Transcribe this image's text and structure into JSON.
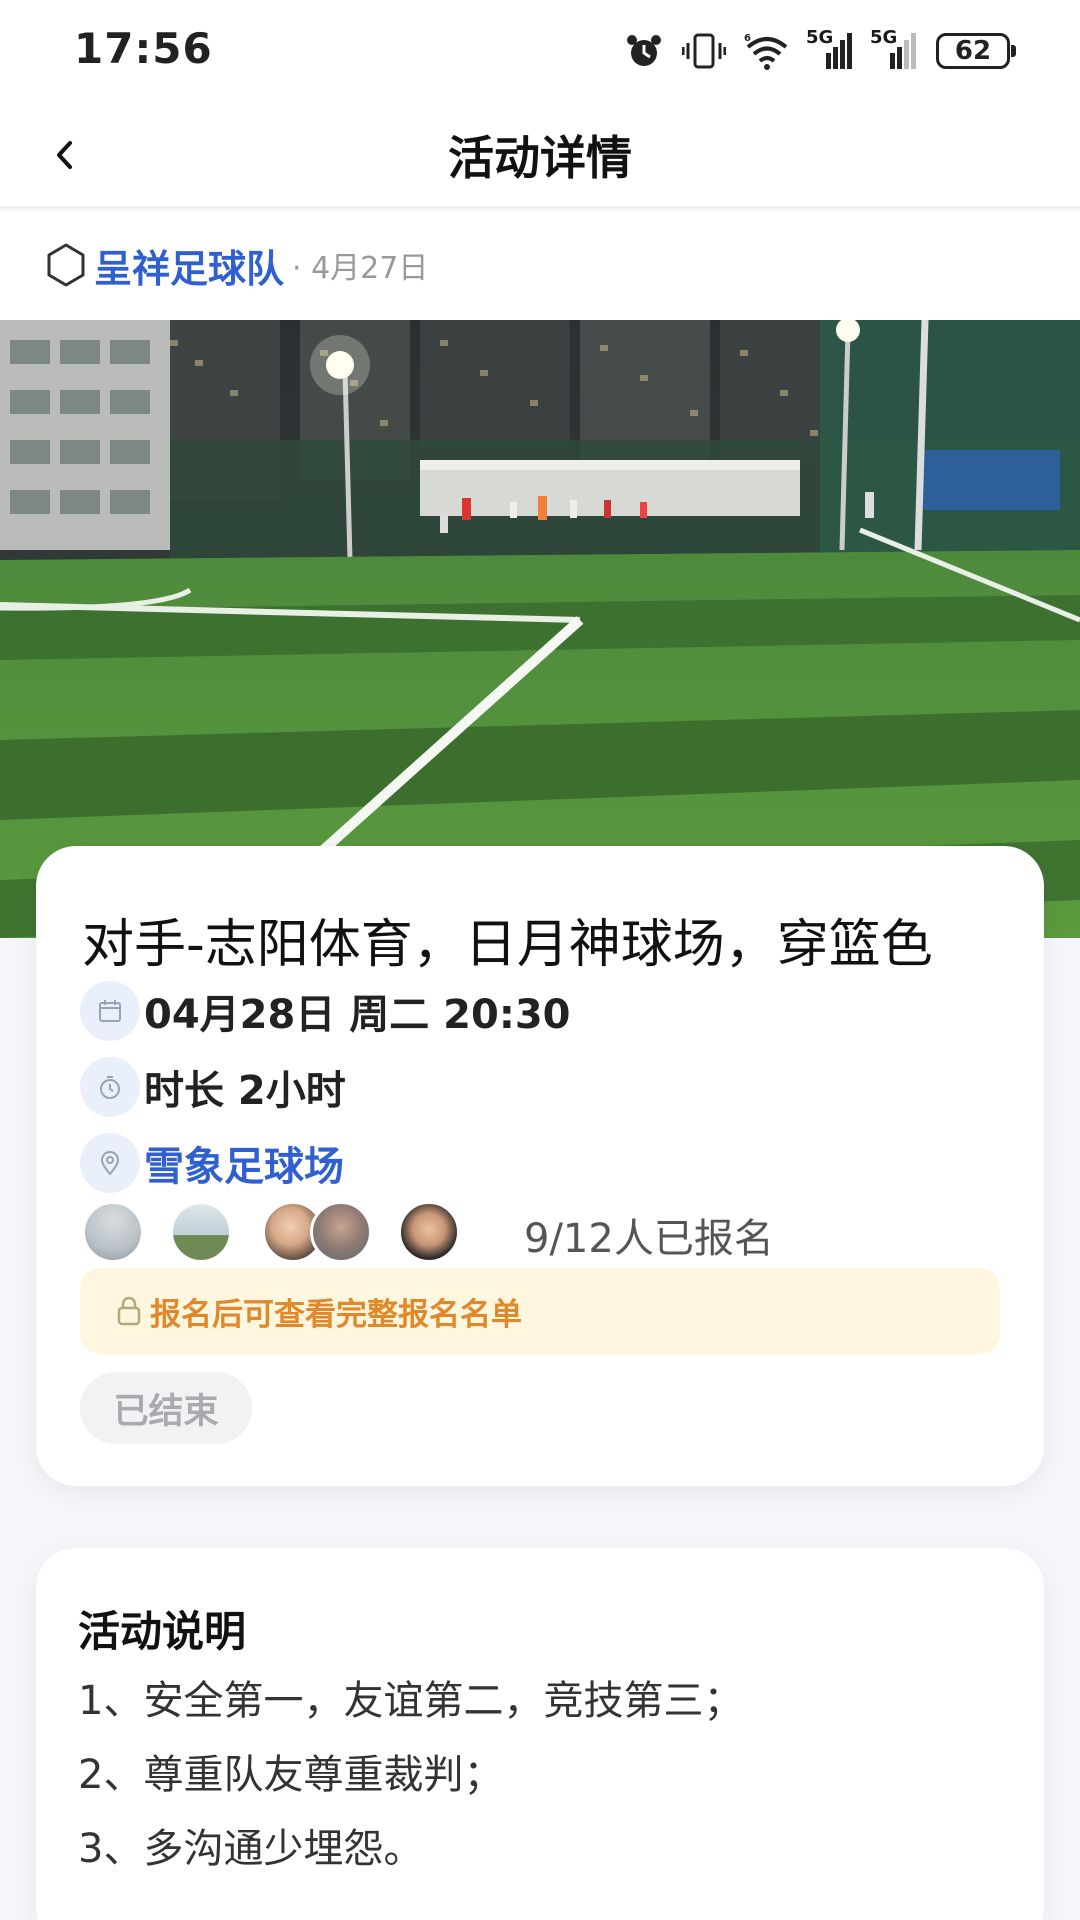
{
  "status_bar": {
    "time": "17:56",
    "network_1": "5G",
    "network_2": "5G",
    "battery": "62"
  },
  "header": {
    "title": "活动详情",
    "back_icon": "chevron-left-icon"
  },
  "team": {
    "name": "呈祥足球队",
    "date": "· 4月27日",
    "icon": "hexagon-icon"
  },
  "hero": {
    "image": "night soccer field photo"
  },
  "activity": {
    "title": "对手-志阳体育，日月神球场，穿篮色",
    "datetime": "04月28日 周二 20:30",
    "duration": "时长 2小时",
    "venue": "雪象足球场",
    "signup_count": "9/12人已报名",
    "notice": "报名后可查看完整报名名单",
    "status": "已结束",
    "icons": {
      "datetime": "calendar-icon",
      "duration": "stopwatch-icon",
      "venue": "location-pin-icon",
      "notice": "lock-icon"
    }
  },
  "description": {
    "title": "活动说明",
    "lines": [
      "1、安全第一，友谊第二，竞技第三；",
      "2、尊重队友尊重裁判；",
      "3、多沟通少埋怨。"
    ]
  },
  "colors": {
    "link": "#2f5fd0",
    "notice_text": "#e0892a",
    "notice_bg": "#fff6df",
    "page_bg": "#f4f6f9"
  }
}
